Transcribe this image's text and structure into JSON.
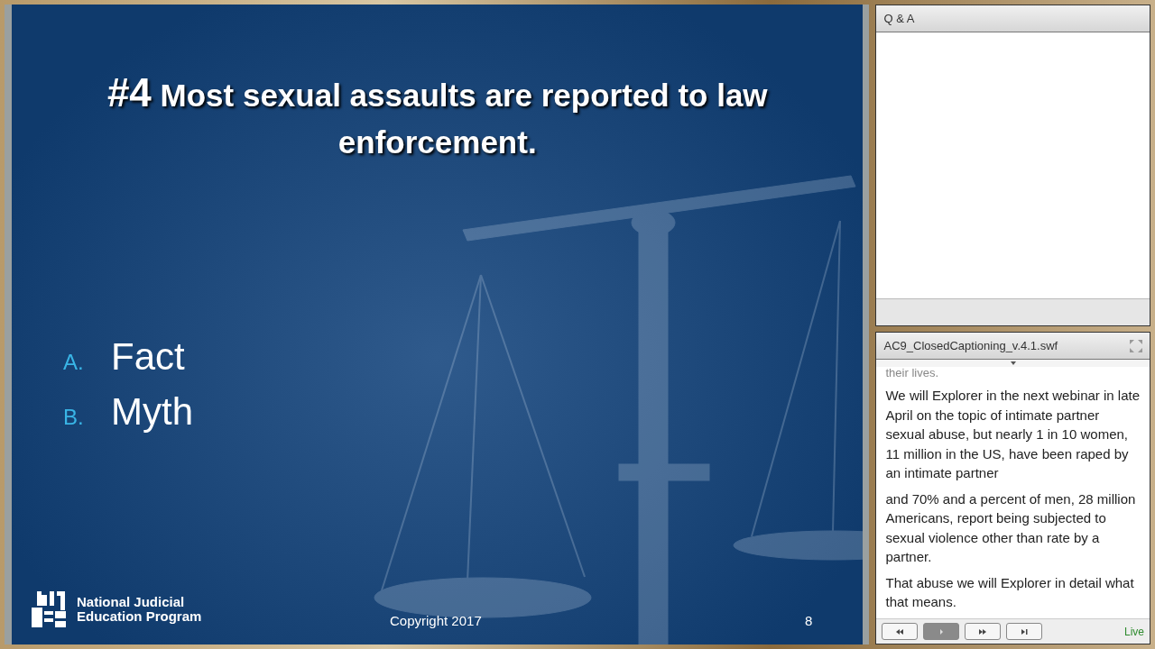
{
  "slide": {
    "number": "#4",
    "title": "Most sexual assaults are reported to law enforcement.",
    "options": [
      {
        "letter": "A.",
        "text": "Fact"
      },
      {
        "letter": "B.",
        "text": "Myth"
      }
    ],
    "footer": {
      "org_line_1": "National Judicial",
      "org_line_2": "Education Program",
      "copyright": "Copyright 2017",
      "page": "8"
    }
  },
  "qa_panel": {
    "title": "Q & A"
  },
  "captions_panel": {
    "title": "AC9_ClosedCaptioning_v.4.1.swf",
    "paragraphs": [
      "their lives.",
      "We will Explorer in the next webinar in late April on the topic of intimate partner sexual abuse, but nearly 1 in 10 women, 11 million in the US, have been raped by an intimate partner",
      "and 70% and a percent of men, 28 million Americans, report being subjected to sexual violence other than rate by a partner.",
      "That abuse we will Explorer in detail what that means."
    ],
    "controls": [
      {
        "kind": "rewind",
        "selected": false
      },
      {
        "kind": "play",
        "selected": true
      },
      {
        "kind": "forward",
        "selected": false
      },
      {
        "kind": "end",
        "selected": false
      }
    ],
    "status": "Live"
  }
}
